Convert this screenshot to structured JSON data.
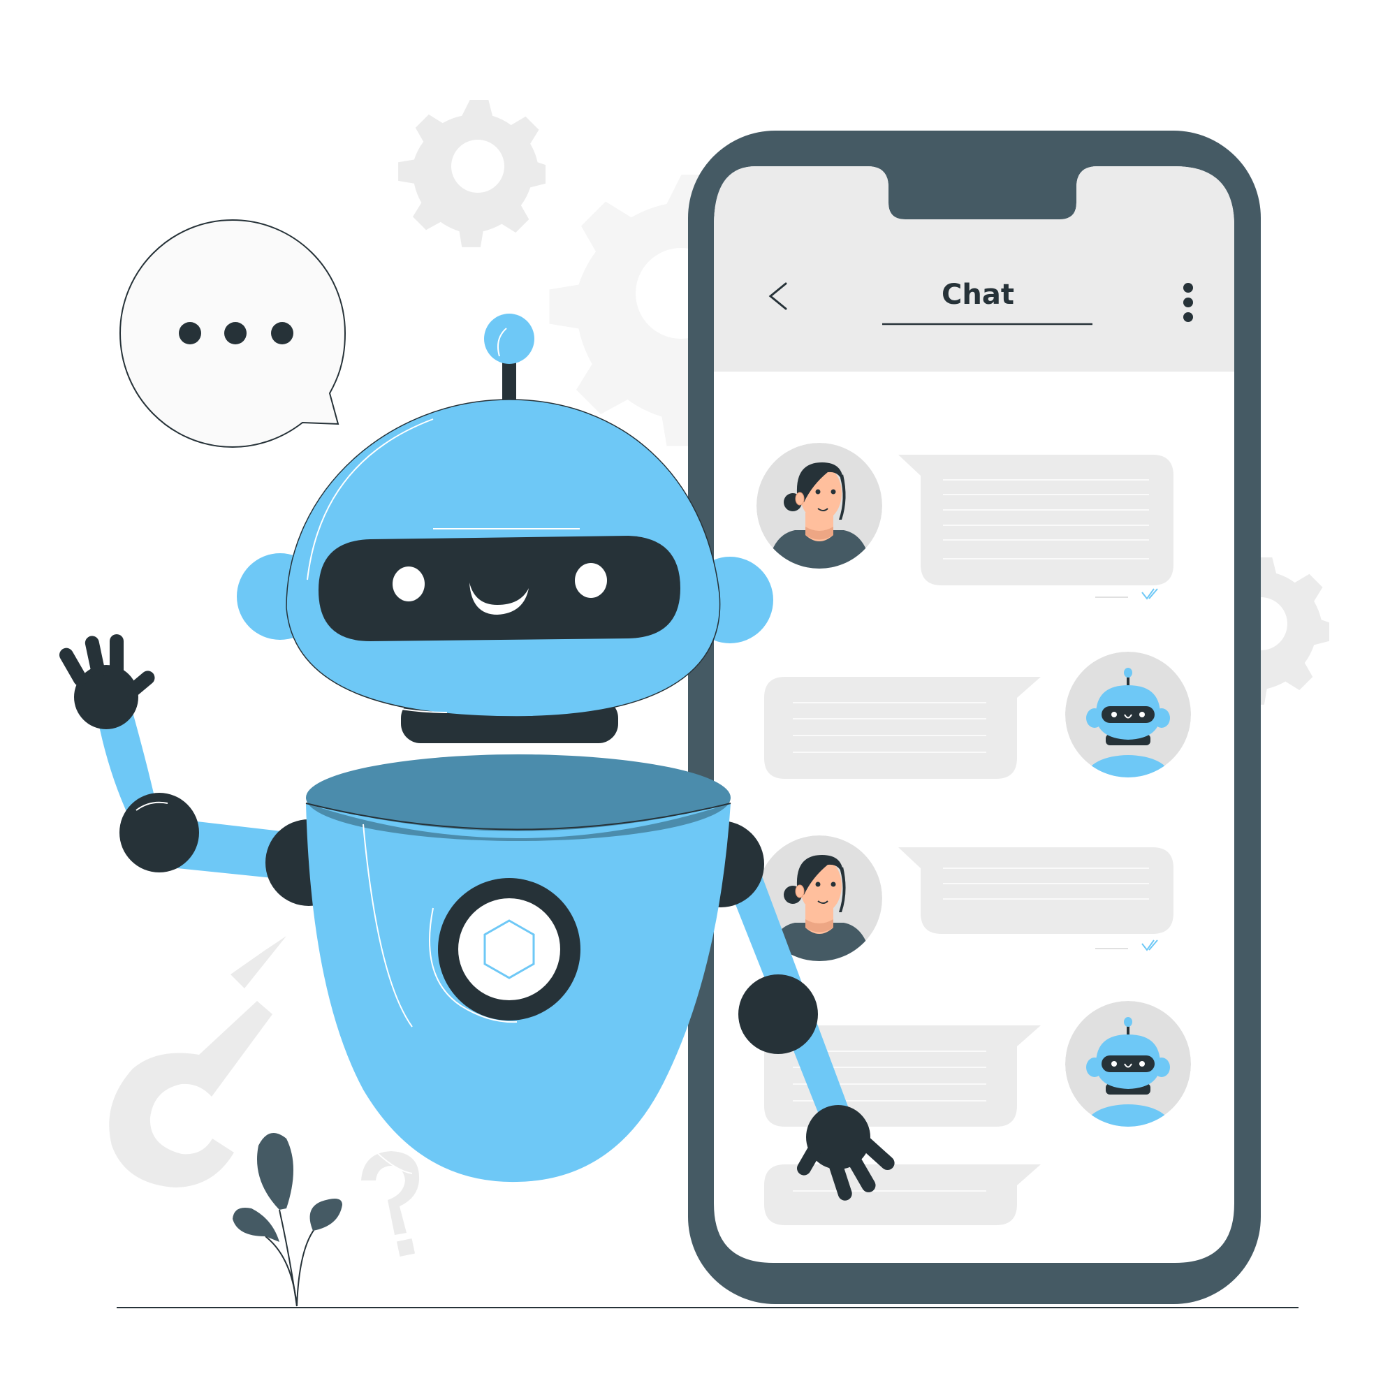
{
  "illustration": {
    "subject": "Chatbot robot waving beside a smartphone chat screen",
    "colors": {
      "robot_blue": "#6ec8f6",
      "robot_blue_dark": "#4b8cac",
      "dark": "#263238",
      "phone_frame": "#455a64",
      "screen_bg": "#ffffff",
      "header_bg": "#ebebeb",
      "bubble_bg": "#ebebeb",
      "avatar_bg": "#e0e0e0",
      "skin": "#ffbf9d",
      "background_shapes": "#ebebeb",
      "read_check": "#6ec8f6"
    }
  },
  "typing_bubble": {
    "icon": "ellipsis-typing-indicator",
    "dots": 3
  },
  "phone": {
    "header": {
      "title": "Chat",
      "back_icon": "chevron-left-icon",
      "menu_icon": "more-vertical-icon"
    },
    "messages": [
      {
        "sender": "user",
        "avatar": "woman-avatar",
        "lines": 6,
        "status": "read",
        "status_icon": "double-check-icon"
      },
      {
        "sender": "bot",
        "avatar": "robot-avatar",
        "lines": 4
      },
      {
        "sender": "user",
        "avatar": "woman-avatar",
        "lines": 3,
        "status": "read",
        "status_icon": "double-check-icon"
      },
      {
        "sender": "bot",
        "avatar": "robot-avatar",
        "lines": 4
      },
      {
        "sender": "bot",
        "lines": 1
      }
    ]
  }
}
